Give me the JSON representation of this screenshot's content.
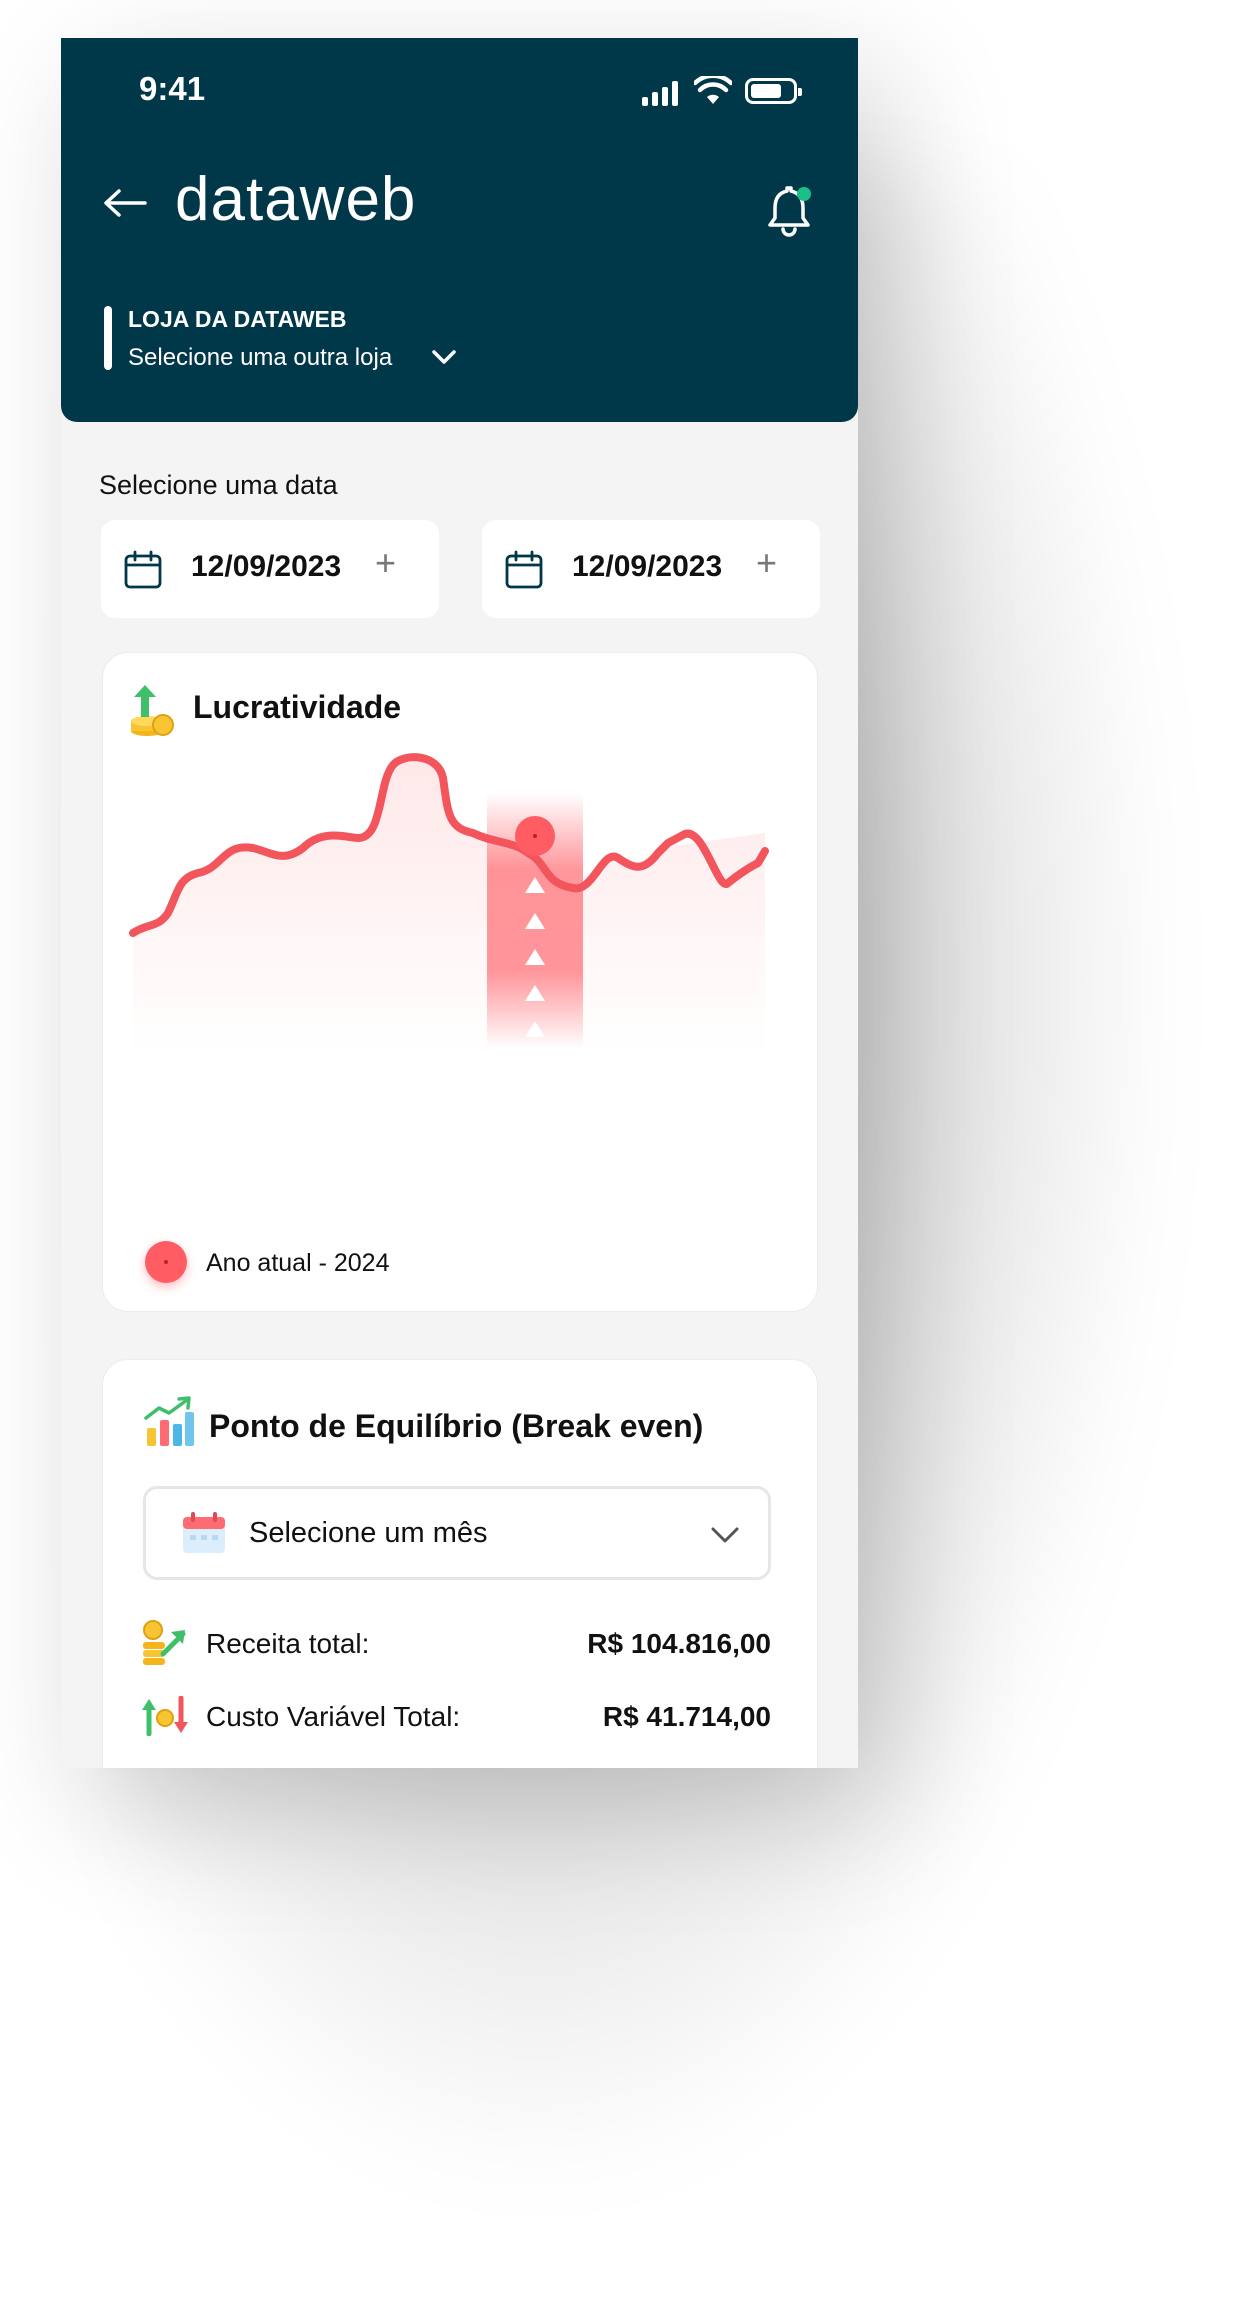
{
  "status_bar": {
    "time": "9:41"
  },
  "header": {
    "logo": "dataweb",
    "store_name": "LOJA DA DATAWEB",
    "store_select": "Selecione uma outra loja"
  },
  "date_section": {
    "label": "Selecione uma data",
    "start_date": "12/09/2023",
    "end_date": "12/09/2023",
    "add_symbol": "+"
  },
  "profit_card": {
    "title": "Lucratividade",
    "legend": "Ano atual - 2024",
    "line_color": "#f2555c"
  },
  "break_even_card": {
    "title": "Ponto de Equilíbrio (Break even)",
    "month_select": "Selecione um mês",
    "rows": [
      {
        "label": "Receita total:",
        "value": "R$ 104.816,00",
        "icon": "revenue-coins-icon"
      },
      {
        "label": "Custo Variável Total:",
        "value": "R$ 41.714,00",
        "icon": "cost-arrows-icon"
      }
    ]
  },
  "colors": {
    "header_bg": "#00384a",
    "accent_red": "#ff5c63",
    "notification_dot": "#19c08a"
  }
}
